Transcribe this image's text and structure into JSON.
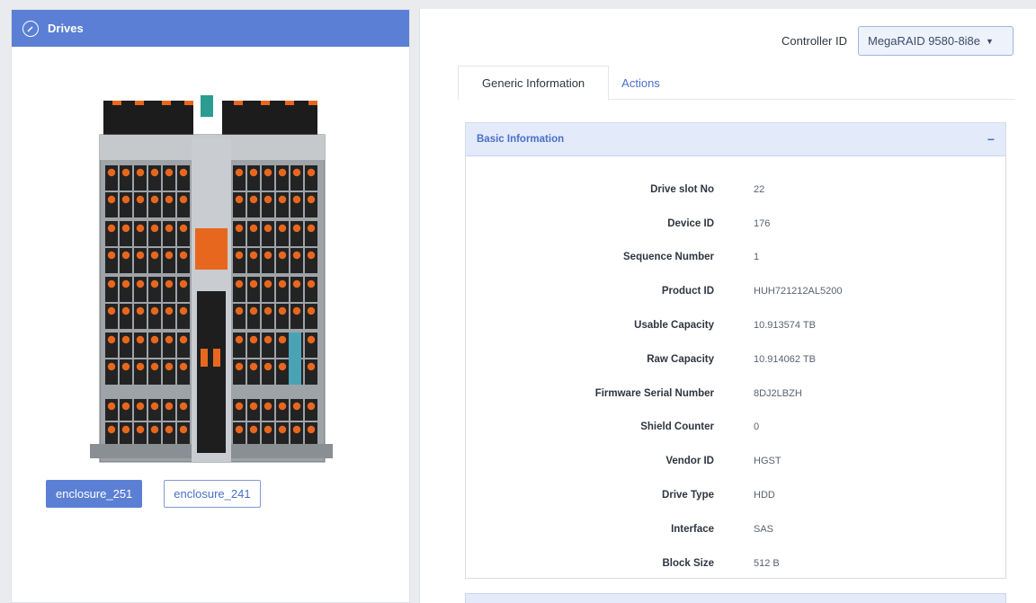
{
  "drives_panel": {
    "title": "Drives",
    "enclosures": [
      {
        "label": "enclosure_251",
        "selected": true
      },
      {
        "label": "enclosure_241",
        "selected": false
      }
    ]
  },
  "controller": {
    "label": "Controller ID",
    "selected": "MegaRAID 9580-8i8e"
  },
  "tabs": [
    {
      "label": "Generic Information",
      "active": true
    },
    {
      "label": "Actions",
      "active": false
    }
  ],
  "basic_info": {
    "title": "Basic Information",
    "collapse_symbol": "−",
    "rows": [
      {
        "key": "Drive slot No",
        "value": "22"
      },
      {
        "key": "Device ID",
        "value": "176"
      },
      {
        "key": "Sequence Number",
        "value": "1"
      },
      {
        "key": "Product ID",
        "value": "HUH721212AL5200"
      },
      {
        "key": "Usable Capacity",
        "value": "10.913574 TB"
      },
      {
        "key": "Raw Capacity",
        "value": "10.914062 TB"
      },
      {
        "key": "Firmware Serial Number",
        "value": "8DJ2LBZH"
      },
      {
        "key": "Shield Counter",
        "value": "0"
      },
      {
        "key": "Vendor ID",
        "value": "HGST"
      },
      {
        "key": "Drive Type",
        "value": "HDD"
      },
      {
        "key": "Interface",
        "value": "SAS"
      },
      {
        "key": "Block Size",
        "value": "512 B"
      }
    ]
  },
  "colors": {
    "accent": "#5b7fd4",
    "drive_orange": "#e8671e",
    "chassis": "#9ea3a8"
  },
  "icons": {
    "header_icon": "gauge-icon",
    "dropdown": "caret-down-icon"
  }
}
